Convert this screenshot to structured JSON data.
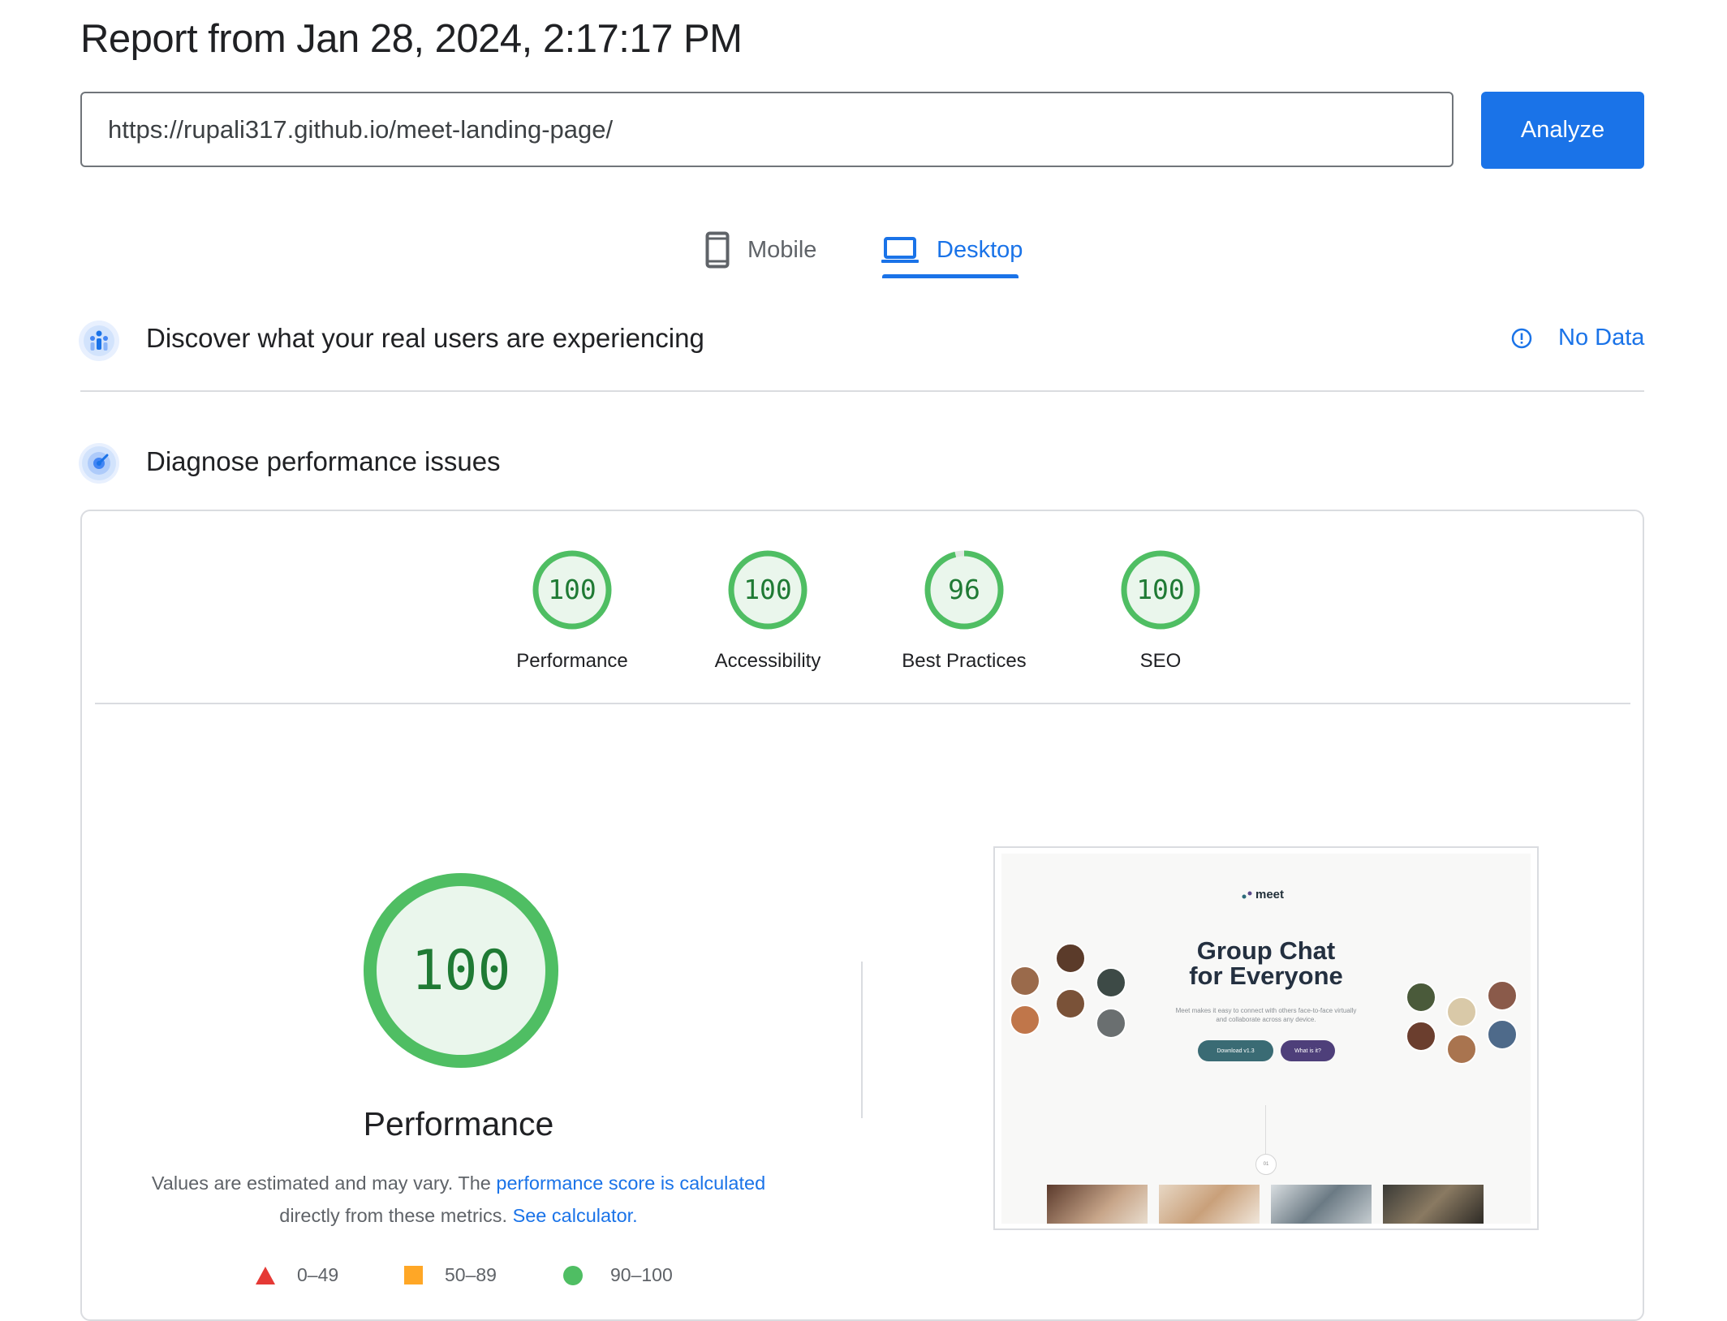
{
  "header": {
    "title": "Report from Jan 28, 2024, 2:17:17 PM",
    "url_value": "https://rupali317.github.io/meet-landing-page/",
    "analyze_label": "Analyze"
  },
  "tabs": [
    {
      "label": "Mobile",
      "icon": "phone-icon",
      "selected": false
    },
    {
      "label": "Desktop",
      "icon": "laptop-icon",
      "selected": true
    }
  ],
  "crux": {
    "title": "Discover what your real users are experiencing",
    "status": "No Data",
    "status_icon": "info-icon"
  },
  "diagnose": {
    "title": "Diagnose performance issues"
  },
  "scores": [
    {
      "label": "Performance",
      "value": "100"
    },
    {
      "label": "Accessibility",
      "value": "100"
    },
    {
      "label": "Best Practices",
      "value": "96"
    },
    {
      "label": "SEO",
      "value": "100"
    }
  ],
  "performance": {
    "score": "100",
    "title": "Performance",
    "desc_prefix": "Values are estimated and may vary. The ",
    "desc_link1": "performance score is calculated",
    "desc_middle": "directly from these metrics. ",
    "desc_link2": "See calculator."
  },
  "legend": [
    {
      "range": "0–49",
      "shape": "triangle",
      "color": "#e53935"
    },
    {
      "range": "50–89",
      "shape": "square",
      "color": "#ffa726"
    },
    {
      "range": "90–100",
      "shape": "circle",
      "color": "#4fbe63"
    }
  ],
  "screenshot": {
    "logo": "meet",
    "headline_line1": "Group Chat",
    "headline_line2": "for Everyone",
    "subtext_line1": "Meet makes it easy to connect with others face-to-face virtually",
    "subtext_line2": "and collaborate across any device.",
    "btn_primary": "Download v1.3",
    "btn_secondary": "What is it?",
    "step_badge": "01"
  },
  "colors": {
    "accent": "#1a73e8",
    "pass_green": "#4fbe63",
    "pass_text": "#1f7a34",
    "pass_fill": "#eaf6ec"
  }
}
